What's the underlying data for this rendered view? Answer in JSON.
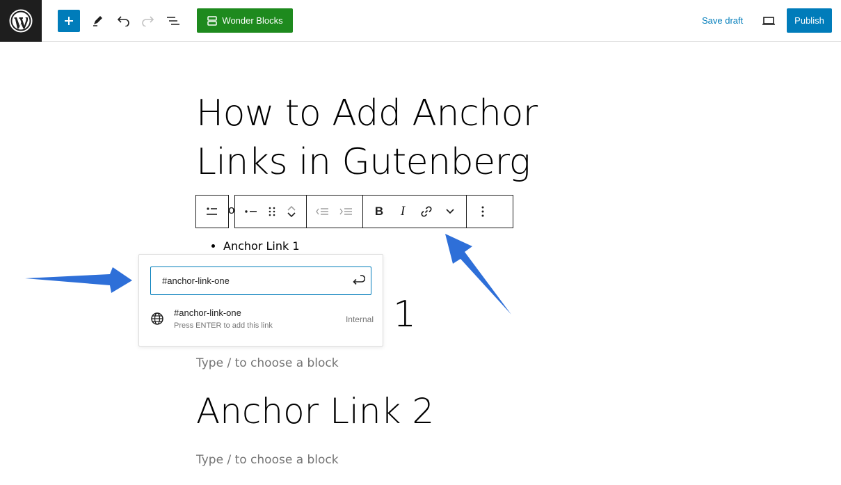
{
  "topbar": {
    "wonder_blocks_label": "Wonder Blocks",
    "save_draft_label": "Save draft",
    "publish_label": "Publish"
  },
  "editor": {
    "post_title": "How to Add Anchor Links in Gutenberg",
    "hidden_char": "o",
    "list_items": [
      "Anchor Link 1"
    ],
    "heading_partial": "1",
    "placeholder_1": "Type / to choose a block",
    "heading_2": "Anchor Link 2",
    "placeholder_2": "Type / to choose a block"
  },
  "block_toolbar": {
    "bold_label": "B",
    "italic_label": "I"
  },
  "link_popover": {
    "input_value": "#anchor-link-one",
    "suggestion_title": "#anchor-link-one",
    "suggestion_hint": "Press ENTER to add this link",
    "suggestion_type": "Internal"
  },
  "icons": {
    "logo": "wordpress-logo-icon",
    "add": "plus-icon",
    "tools": "pencil-icon",
    "undo": "undo-icon",
    "redo": "redo-icon",
    "outline": "document-overview-icon",
    "preview": "laptop-icon",
    "link": "link-icon",
    "globe": "globe-icon",
    "enter": "enter-icon"
  },
  "colors": {
    "accent": "#007cba",
    "wonder_green": "#1e8a1e",
    "annotation_arrow": "#2e6fd8",
    "dark": "#1e1e1e"
  }
}
